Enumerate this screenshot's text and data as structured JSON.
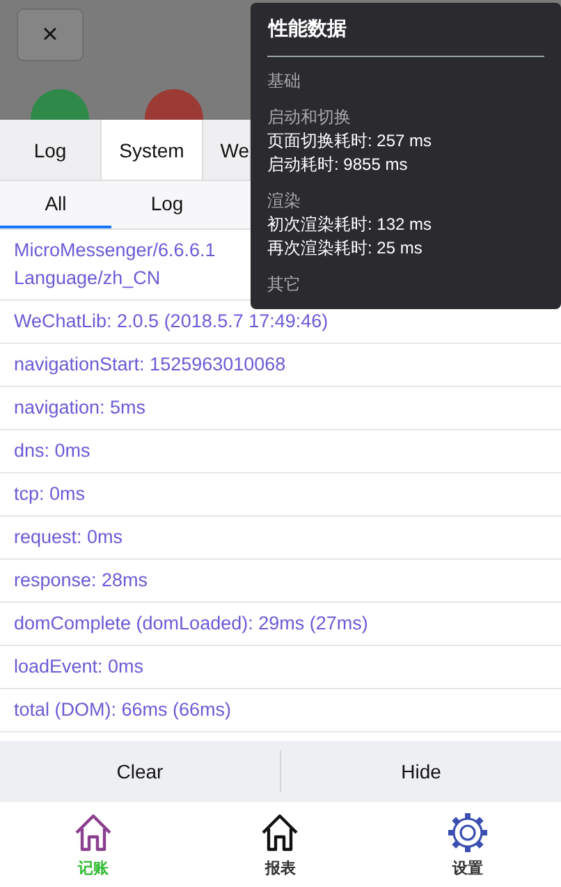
{
  "header": {
    "close_label": "×"
  },
  "tabs": [
    {
      "label": "Log",
      "selected": false
    },
    {
      "label": "System",
      "selected": true
    },
    {
      "label": "We",
      "selected": false
    }
  ],
  "filters": [
    {
      "label": "All",
      "selected": true
    },
    {
      "label": "Log",
      "selected": false
    }
  ],
  "rows": [
    [
      "MicroMessenger/6.6.6.1",
      "Language/zh_CN"
    ],
    [
      "WeChatLib: 2.0.5 (2018.5.7 17:49:46)"
    ],
    [
      "navigationStart: 1525963010068"
    ],
    [
      "navigation: 5ms"
    ],
    [
      "dns: 0ms"
    ],
    [
      "tcp: 0ms"
    ],
    [
      "request: 0ms"
    ],
    [
      "response: 28ms"
    ],
    [
      "domComplete (domLoaded): 29ms (27ms)"
    ],
    [
      "loadEvent: 0ms"
    ],
    [
      "total (DOM): 66ms (66ms)"
    ]
  ],
  "actions": [
    "Clear",
    "Hide"
  ],
  "perf_panel": {
    "title": "性能数据",
    "sections": [
      {
        "kind": "heading",
        "text": "基础"
      },
      {
        "kind": "heading",
        "text": "启动和切换"
      },
      {
        "kind": "metric",
        "text": "页面切换耗时: 257 ms"
      },
      {
        "kind": "metric",
        "text": "启动耗时: 9855 ms"
      },
      {
        "kind": "heading",
        "text": "渲染"
      },
      {
        "kind": "metric",
        "text": "初次渲染耗时: 132 ms"
      },
      {
        "kind": "metric",
        "text": "再次渲染耗时: 25 ms"
      },
      {
        "kind": "heading",
        "text": "其它"
      }
    ]
  },
  "bottom_nav": [
    {
      "label": "记账",
      "selected": true
    },
    {
      "label": "报表",
      "selected": false
    },
    {
      "label": "设置",
      "selected": false
    }
  ]
}
